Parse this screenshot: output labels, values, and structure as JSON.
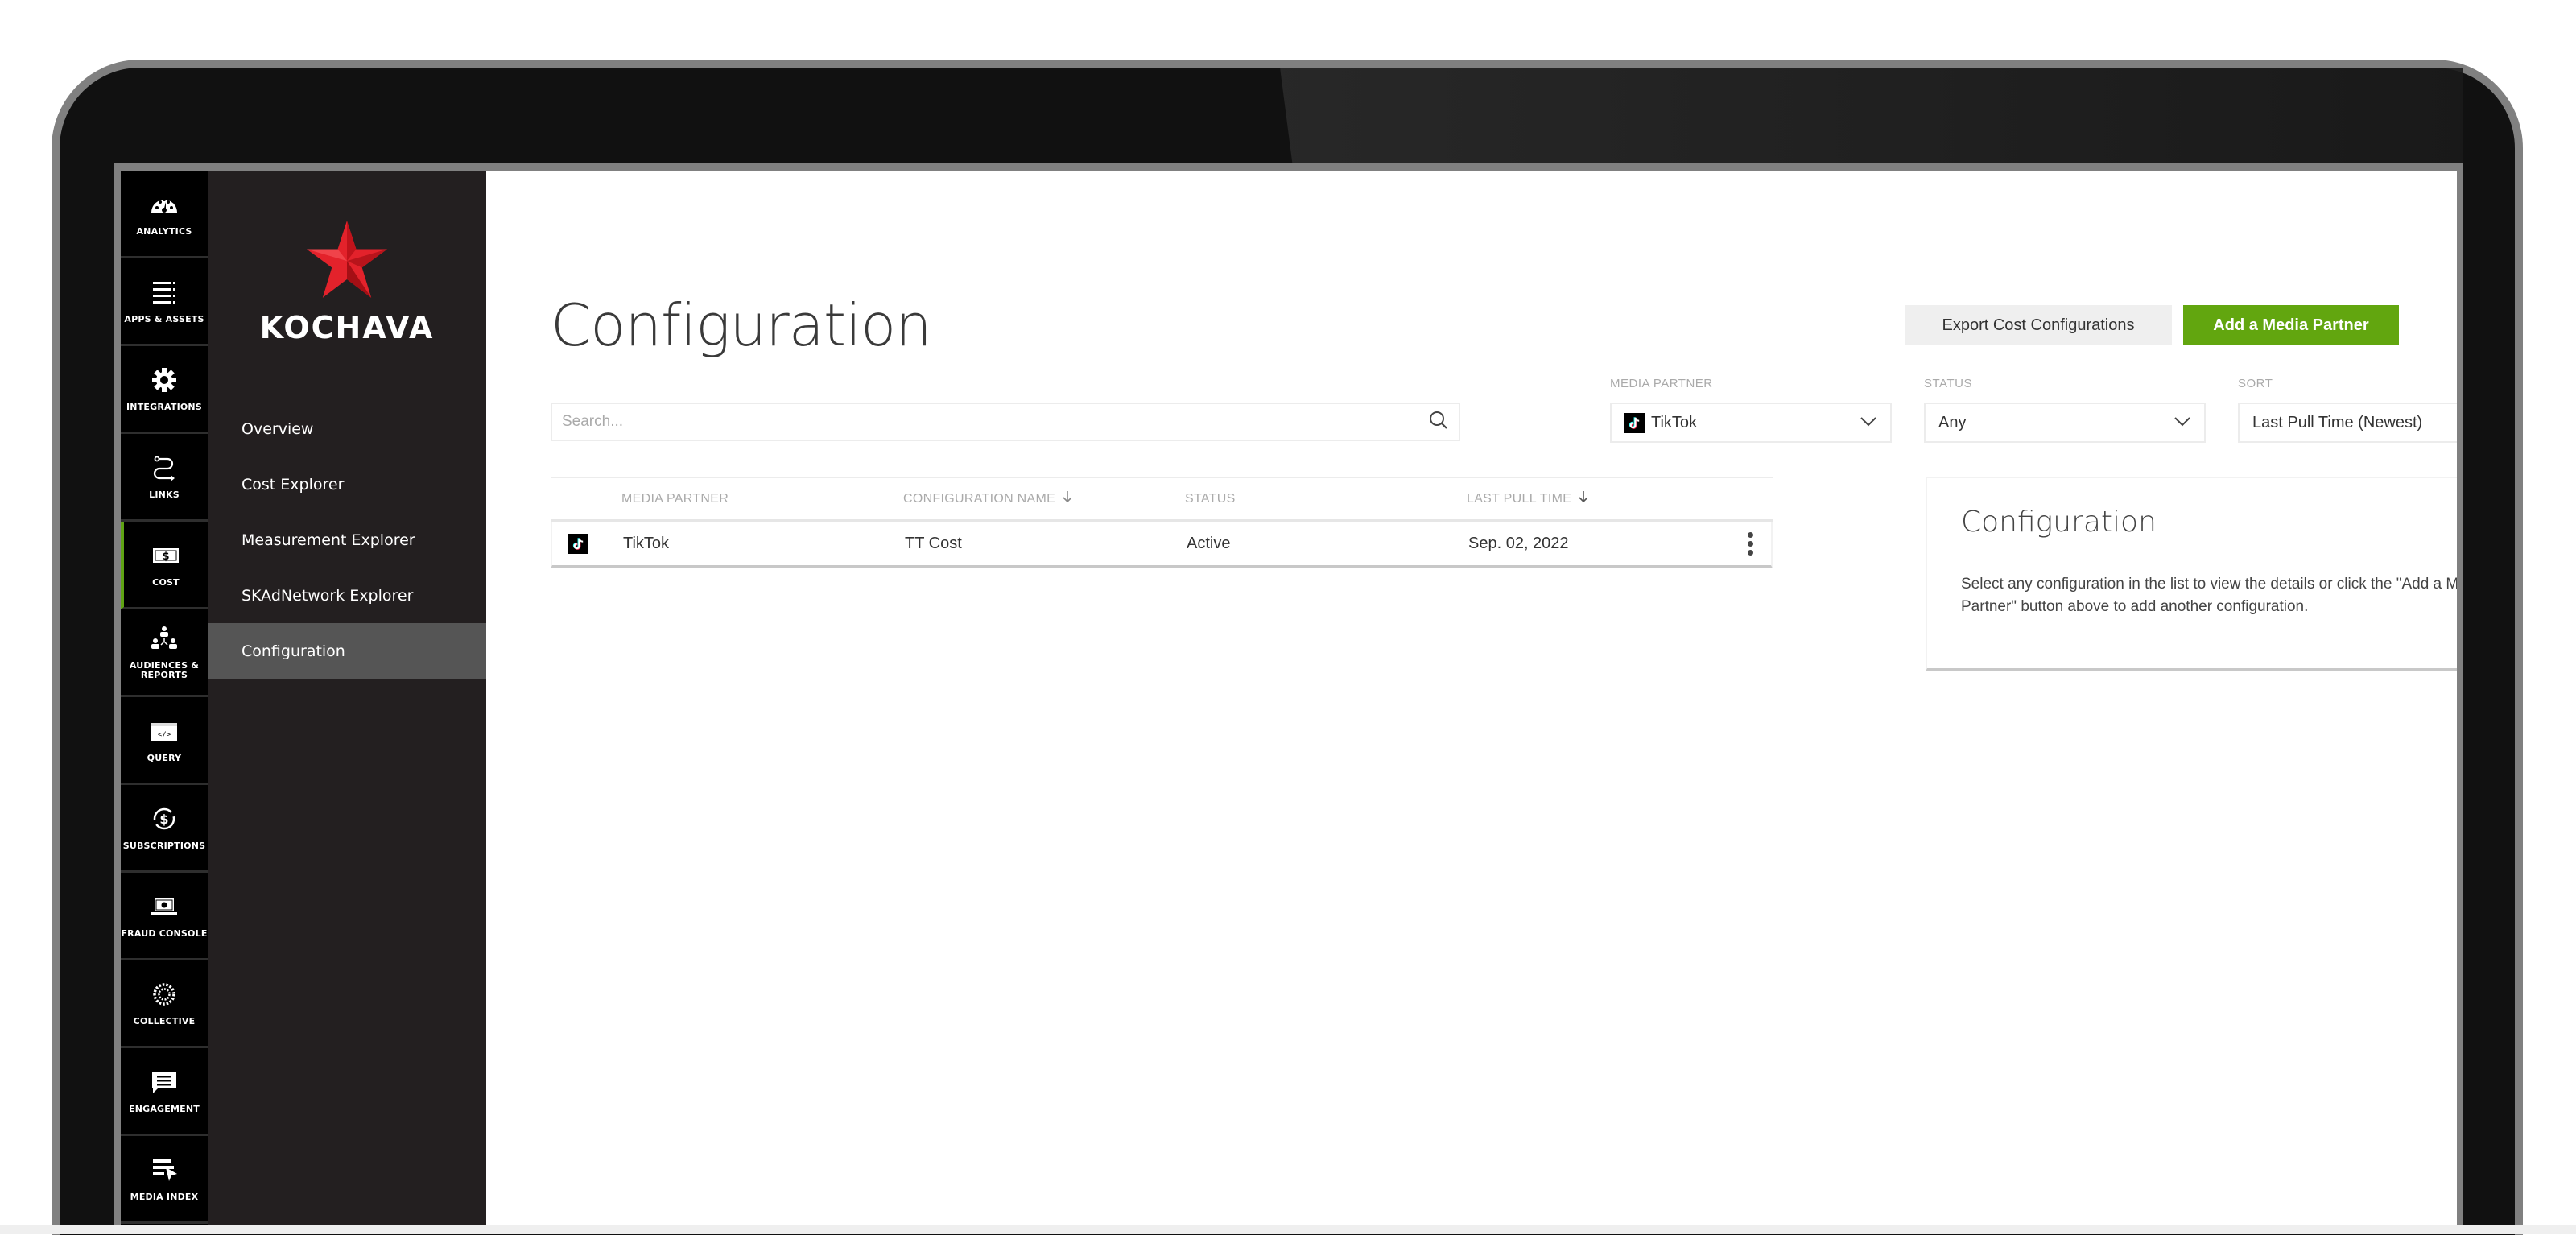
{
  "rail": {
    "items": [
      {
        "label": "ANALYTICS",
        "icon": "dashboard-gauge-icon",
        "active": false
      },
      {
        "label": "APPS & ASSETS",
        "icon": "list-icon",
        "active": false
      },
      {
        "label": "INTEGRATIONS",
        "icon": "gear-icon",
        "active": false
      },
      {
        "label": "LINKS",
        "icon": "link-path-icon",
        "active": false
      },
      {
        "label": "COST",
        "icon": "dollar-bill-icon",
        "active": true
      },
      {
        "label": "AUDIENCES & REPORTS",
        "icon": "org-chart-icon",
        "active": false
      },
      {
        "label": "QUERY",
        "icon": "code-window-icon",
        "active": false
      },
      {
        "label": "SUBSCRIPTIONS",
        "icon": "recurring-dollar-icon",
        "active": false
      },
      {
        "label": "FRAUD CONSOLE",
        "icon": "laptop-alert-icon",
        "active": false
      },
      {
        "label": "COLLECTIVE",
        "icon": "dots-circle-icon",
        "active": false
      },
      {
        "label": "ENGAGEMENT",
        "icon": "chat-bubble-icon",
        "active": false
      },
      {
        "label": "MEDIA INDEX",
        "icon": "list-cursor-icon",
        "active": false
      }
    ],
    "active_color": "#5fa314"
  },
  "subnav": {
    "brand": "KOCHAVA",
    "brand_color": "#e3222b",
    "items": [
      {
        "label": "Overview",
        "active": false
      },
      {
        "label": "Cost Explorer",
        "active": false
      },
      {
        "label": "Measurement Explorer",
        "active": false
      },
      {
        "label": "SKAdNetwork Explorer",
        "active": false
      },
      {
        "label": "Configuration",
        "active": true
      }
    ]
  },
  "header": {
    "title": "Configuration",
    "export_label": "Export Cost Configurations",
    "add_label": "Add a Media Partner",
    "accent_color": "#62a60f"
  },
  "filters": {
    "search_placeholder": "Search...",
    "search_value": "",
    "media_partner": {
      "label": "MEDIA PARTNER",
      "value": "TikTok"
    },
    "status": {
      "label": "STATUS",
      "value": "Any"
    },
    "sort": {
      "label": "SORT",
      "value": "Last Pull Time (Newest)"
    }
  },
  "table": {
    "columns": [
      {
        "label": "MEDIA PARTNER",
        "sorted": false
      },
      {
        "label": "CONFIGURATION NAME",
        "sorted": true
      },
      {
        "label": "STATUS",
        "sorted": false
      },
      {
        "label": "LAST PULL TIME",
        "sorted": true
      }
    ],
    "rows": [
      {
        "partner": "TikTok",
        "name": "TT Cost",
        "status": "Active",
        "last_pull": "Sep. 02, 2022"
      }
    ]
  },
  "panel": {
    "title": "Configuration",
    "text": "Select any configuration in the list to view the details or click the \"Add a Media Partner\" button above to add another configuration."
  }
}
